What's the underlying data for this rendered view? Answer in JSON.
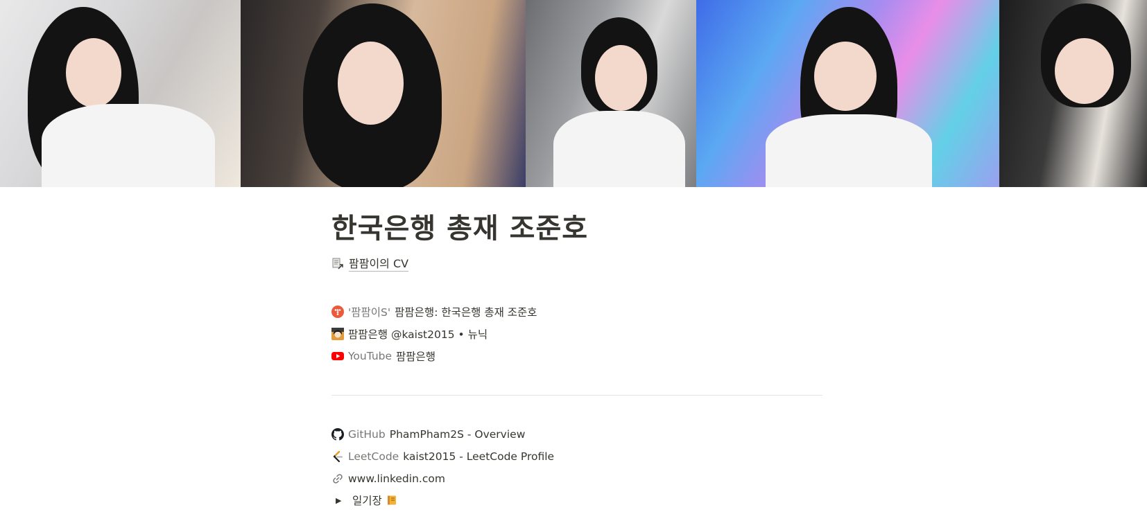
{
  "page": {
    "title": "한국은행 총재 조준호",
    "cv_link": {
      "icon": "document-link-icon",
      "label": "팜팜이의 CV"
    }
  },
  "social_links": [
    {
      "icon": "tistory-icon",
      "icon_color": "#eb5a3c",
      "site": "'팜팜이S'",
      "title": "팜팜은행: 한국은행 총재 조준호"
    },
    {
      "icon": "avatar-icon",
      "icon_color": "#d9812a",
      "site": "",
      "title": "팜팜은행 @kaist2015 • 뉴닉"
    },
    {
      "icon": "youtube-icon",
      "icon_color": "#ff0000",
      "site": "YouTube",
      "title": "팜팜은행"
    }
  ],
  "dev_links": [
    {
      "icon": "github-icon",
      "icon_color": "#1b1f23",
      "site": "GitHub",
      "title": "PhamPham2S - Overview"
    },
    {
      "icon": "leetcode-icon",
      "icon_color": "#f89f1b",
      "site": "LeetCode",
      "title": "kaist2015 - LeetCode Profile"
    },
    {
      "icon": "link-icon",
      "icon_color": "#787774",
      "site": "",
      "title": "www.linkedin.com"
    }
  ],
  "toggle": {
    "icon": "notebook-icon",
    "label": "일기장",
    "expanded": false
  },
  "colors": {
    "text": "#37352f",
    "muted": "#787774",
    "divider": "#e3e2df"
  }
}
